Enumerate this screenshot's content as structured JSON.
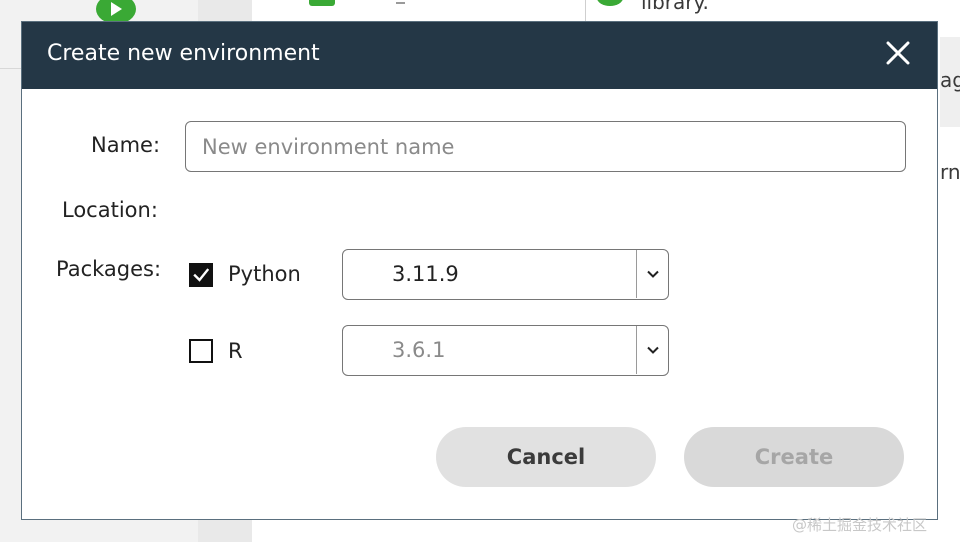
{
  "background": {
    "top_text": "library.",
    "right_text_1": "ag",
    "right_text_2": "rn"
  },
  "dialog": {
    "title": "Create new environment",
    "close_icon": "close-icon",
    "fields": {
      "name_label": "Name:",
      "name_placeholder": "New environment name",
      "name_value": "",
      "location_label": "Location:",
      "packages_label": "Packages:"
    },
    "packages": [
      {
        "label": "Python",
        "checked": true,
        "version": "3.11.9",
        "enabled": true
      },
      {
        "label": "R",
        "checked": false,
        "version": "3.6.1",
        "enabled": false
      }
    ],
    "buttons": {
      "cancel": "Cancel",
      "create": "Create"
    }
  },
  "watermark": "@稀土掘金技术社区",
  "colors": {
    "header_bg": "#243746",
    "accent_green": "#3aa935",
    "button_bg": "#e1e1e1"
  }
}
